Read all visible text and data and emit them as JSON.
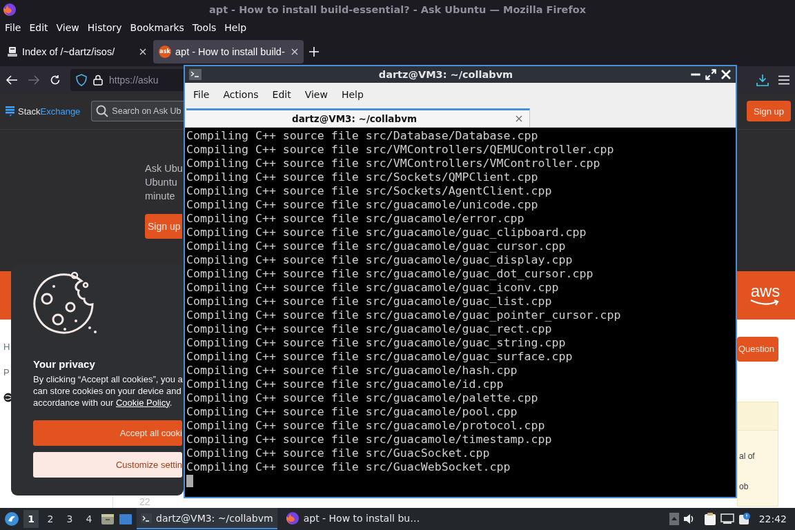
{
  "browser": {
    "title": "apt - How to install build-essential? - Ask Ubuntu — Mozilla Firefox",
    "menu": [
      "File",
      "Edit",
      "View",
      "History",
      "Bookmarks",
      "Tools",
      "Help"
    ],
    "tabs": [
      {
        "label": "Index of /~dartz/isos/",
        "selected": false,
        "kind": "server"
      },
      {
        "label": "apt - How to install build-",
        "selected": true,
        "kind": "ask",
        "favicon_text": "ask"
      }
    ],
    "forward_button": {
      "disabled": true
    },
    "url": "https://asku",
    "page": {
      "logo_parts": [
        "Stack",
        "Exchange"
      ],
      "search_placeholder": "Search on Ask Ub",
      "top_button": "Sign up",
      "hero_lines": [
        "Ask Ubu",
        "Ubuntu",
        "minute"
      ],
      "hero_button": "Sign up",
      "banner_logo": "aws",
      "sidebar_fragments": [
        "H",
        "P"
      ],
      "vote_count": "22",
      "ask_button": "Question",
      "side_box_lines": [
        "al of",
        "ob"
      ]
    }
  },
  "cookie_dialog": {
    "title": "Your privacy",
    "text_lines": [
      "By clicking “Accept all cookies”, you a",
      "can store cookies on your device and",
      "accordance with our "
    ],
    "link": "Cookie Policy",
    "after_link": ".",
    "accept_button": "Accept all cooki",
    "customize_button": "Customize settin"
  },
  "terminal": {
    "title": "dartz@VM3: ~/collabvm",
    "menu": [
      "File",
      "Actions",
      "Edit",
      "View",
      "Help"
    ],
    "tabs": [
      {
        "label": "dartz@VM3: ~/collabvm",
        "selected": true
      }
    ],
    "lines": [
      "Compiling C++ source file src/Database/Database.cpp",
      "Compiling C++ source file src/VMControllers/QEMUController.cpp",
      "Compiling C++ source file src/VMControllers/VMController.cpp",
      "Compiling C++ source file src/Sockets/QMPClient.cpp",
      "Compiling C++ source file src/Sockets/AgentClient.cpp",
      "Compiling C++ source file src/guacamole/unicode.cpp",
      "Compiling C++ source file src/guacamole/error.cpp",
      "Compiling C++ source file src/guacamole/guac_clipboard.cpp",
      "Compiling C++ source file src/guacamole/guac_cursor.cpp",
      "Compiling C++ source file src/guacamole/guac_display.cpp",
      "Compiling C++ source file src/guacamole/guac_dot_cursor.cpp",
      "Compiling C++ source file src/guacamole/guac_iconv.cpp",
      "Compiling C++ source file src/guacamole/guac_list.cpp",
      "Compiling C++ source file src/guacamole/guac_pointer_cursor.cpp",
      "Compiling C++ source file src/guacamole/guac_rect.cpp",
      "Compiling C++ source file src/guacamole/guac_string.cpp",
      "Compiling C++ source file src/guacamole/guac_surface.cpp",
      "Compiling C++ source file src/guacamole/hash.cpp",
      "Compiling C++ source file src/guacamole/id.cpp",
      "Compiling C++ source file src/guacamole/palette.cpp",
      "Compiling C++ source file src/guacamole/pool.cpp",
      "Compiling C++ source file src/guacamole/protocol.cpp",
      "Compiling C++ source file src/guacamole/timestamp.cpp",
      "Compiling C++ source file src/GuacSocket.cpp",
      "Compiling C++ source file src/GuacWebSocket.cpp"
    ]
  },
  "taskbar": {
    "workspaces": [
      {
        "label": "1",
        "selected": true
      },
      {
        "label": "2",
        "selected": false
      },
      {
        "label": "3",
        "selected": false
      },
      {
        "label": "4",
        "selected": false
      }
    ],
    "tasks": [
      {
        "label": "dartz@VM3: ~/collabvm",
        "selected": true,
        "kind": "terminal"
      },
      {
        "label": "apt - How to install bu…",
        "selected": false,
        "kind": "browser"
      }
    ],
    "clock": "22:42"
  }
}
